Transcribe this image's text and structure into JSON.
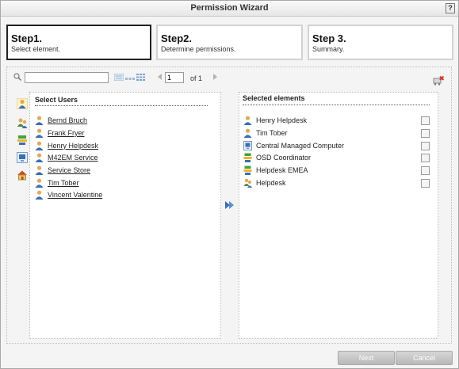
{
  "window": {
    "title": "Permission Wizard",
    "help_label": "?"
  },
  "steps": [
    {
      "title": "Step1.",
      "subtitle": "Select element."
    },
    {
      "title": "Step2.",
      "subtitle": "Determine permissions."
    },
    {
      "title": "Step 3.",
      "subtitle": "Summary."
    }
  ],
  "search": {
    "value": "",
    "placeholder": ""
  },
  "pager": {
    "page": "1",
    "of_label": "of 1"
  },
  "left_panel": {
    "title": "Select Users",
    "users": [
      "Bernd Bruch",
      "Frank Fryer",
      "Henry Helpdesk",
      "M42EM Service",
      "Service Store",
      "Tim Tober",
      "Vincent Valentine"
    ]
  },
  "right_panel": {
    "title": "Selected elements",
    "items": [
      {
        "label": "Henry Helpdesk",
        "icon": "user-icon"
      },
      {
        "label": "Tim Tober",
        "icon": "user-icon"
      },
      {
        "label": "Central Managed Computer",
        "icon": "computer-icon"
      },
      {
        "label": "OSD Coordinator",
        "icon": "group-icon"
      },
      {
        "label": "Helpdesk EMEA",
        "icon": "group-icon"
      },
      {
        "label": "Helpdesk",
        "icon": "role-icon"
      }
    ]
  },
  "buttons": {
    "next": "Next",
    "cancel": "Cancel"
  },
  "colors": {
    "accent_blue": "#3a6fb0",
    "active_step_border": "#222222",
    "button_gray": "#c4c4c4"
  }
}
